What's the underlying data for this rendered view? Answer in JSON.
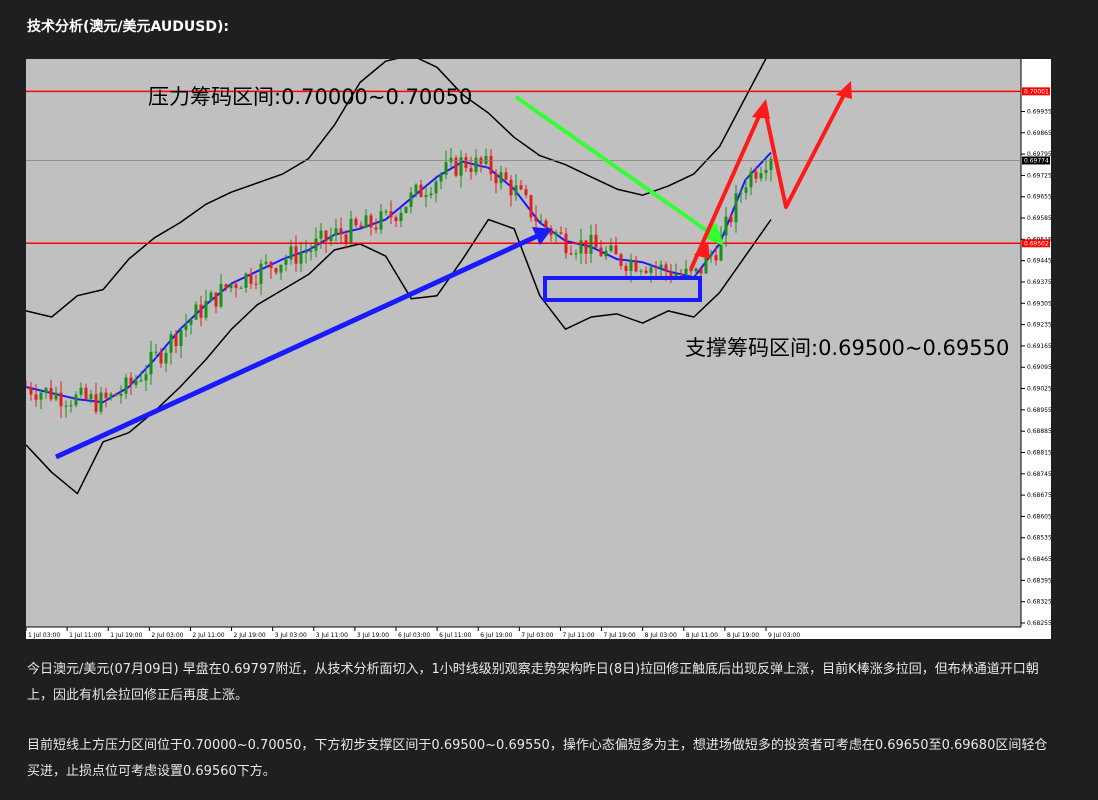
{
  "article": {
    "heading": "技术分析(澳元/美元AUDUSD):",
    "paragraph1": "今日澳元/美元(07月09日) 早盘在0.69797附近，从技术分析面切入，1小时线级别观察走势架构昨日(8日)拉回修正触底后出现反弹上涨，目前K棒涨多拉回，但布林通道开口朝上，因此有机会拉回修正后再度上涨。",
    "paragraph2": "目前短线上方压力区间位于0.70000~0.70050，下方初步支撑区间于0.69500~0.69550，操作心态偏短多为主，想进场做短多的投资者可考虑在0.69650至0.69680区间轻仓买进，止损点位可考虑设置0.69560下方。"
  },
  "chart_data": {
    "type": "candlestick",
    "symbol": "AUDUSD",
    "timeframe": "H1",
    "ylim": [
      0.68255,
      0.70035
    ],
    "y_ticks": [
      "0.69935",
      "0.69865",
      "0.69795",
      "0.69725",
      "0.69655",
      "0.69585",
      "0.69515",
      "0.69445",
      "0.69375",
      "0.69305",
      "0.69235",
      "0.69165",
      "0.69095",
      "0.69025",
      "0.68955",
      "0.68885",
      "0.68815",
      "0.68745",
      "0.68675",
      "0.68605",
      "0.68535",
      "0.68465",
      "0.68395",
      "0.68325",
      "0.68255"
    ],
    "x_ticks": [
      "1 Jul 03:00",
      "1 Jul 11:00",
      "1 Jul 19:00",
      "2 Jul 03:00",
      "2 Jul 11:00",
      "2 Jul 19:00",
      "3 Jul 03:00",
      "3 Jul 11:00",
      "3 Jul 19:00",
      "6 Jul 03:00",
      "6 Jul 11:00",
      "6 Jul 19:00",
      "7 Jul 03:00",
      "7 Jul 11:00",
      "7 Jul 19:00",
      "8 Jul 03:00",
      "8 Jul 11:00",
      "8 Jul 19:00",
      "9 Jul 03:00"
    ],
    "horizontal_lines": [
      {
        "label": "0.70001",
        "value": 0.70001,
        "color": "#ff0000"
      },
      {
        "label": "0.69502",
        "value": 0.69502,
        "color": "#ff0000"
      }
    ],
    "current_price": {
      "label": "0.69774",
      "value": 0.69774
    },
    "annotations": {
      "resistance": "压力筹码区间:0.70000~0.70050",
      "support": "支撑筹码区间:0.69500~0.69550"
    },
    "bollinger_mid": [
      0.6903,
      0.6901,
      0.6899,
      0.6898,
      0.6903,
      0.6912,
      0.6922,
      0.693,
      0.6937,
      0.6941,
      0.6945,
      0.6948,
      0.6953,
      0.6955,
      0.6958,
      0.6965,
      0.6972,
      0.6977,
      0.6975,
      0.6968,
      0.6957,
      0.6951,
      0.6949,
      0.6945,
      0.6944,
      0.6941,
      0.6939,
      0.695,
      0.6971,
      0.698
    ],
    "bollinger_upper": [
      0.6928,
      0.6926,
      0.6933,
      0.6935,
      0.6945,
      0.6952,
      0.6957,
      0.6963,
      0.6967,
      0.697,
      0.6973,
      0.6978,
      0.6989,
      0.7003,
      0.701,
      0.7012,
      0.7008,
      0.6999,
      0.6993,
      0.6985,
      0.6979,
      0.6976,
      0.6972,
      0.6968,
      0.6966,
      0.6969,
      0.6973,
      0.6982,
      0.6998,
      0.7014
    ],
    "bollinger_lower": [
      0.6884,
      0.6875,
      0.6868,
      0.6885,
      0.6888,
      0.6895,
      0.6903,
      0.6912,
      0.6922,
      0.693,
      0.6935,
      0.694,
      0.6948,
      0.695,
      0.6946,
      0.6932,
      0.6933,
      0.6945,
      0.6958,
      0.6955,
      0.6933,
      0.6922,
      0.6926,
      0.6927,
      0.6924,
      0.6928,
      0.6926,
      0.6934,
      0.6946,
      0.6958
    ]
  }
}
